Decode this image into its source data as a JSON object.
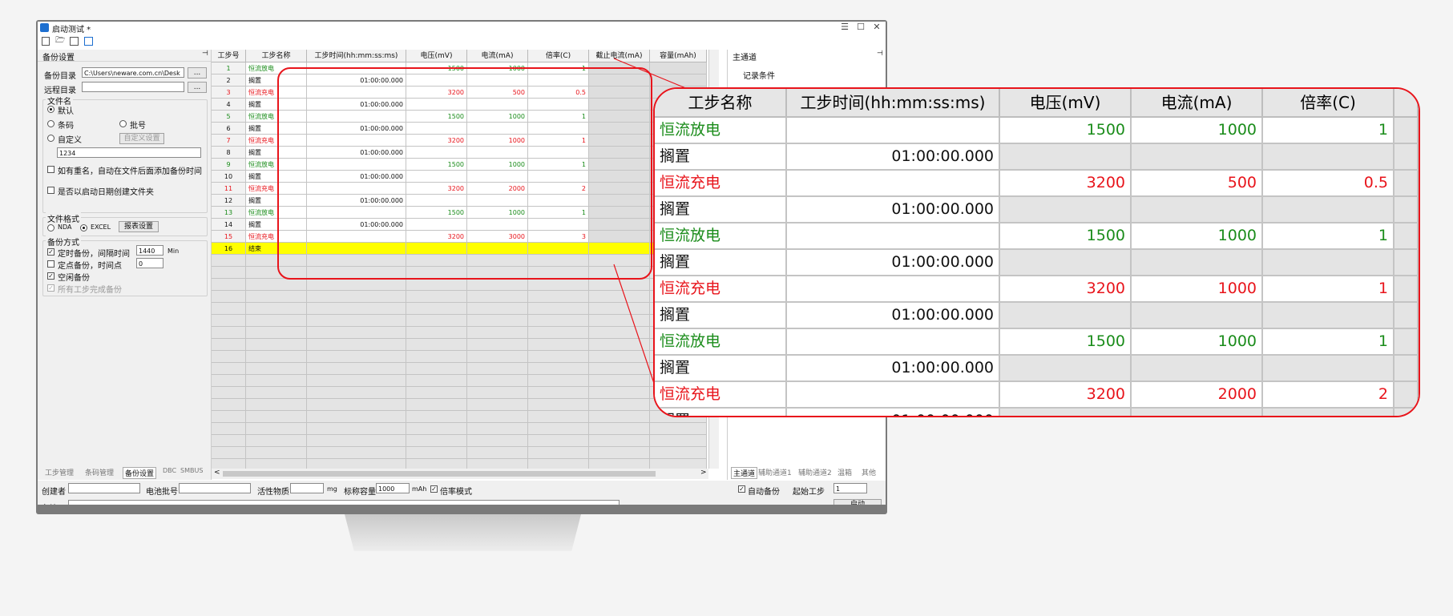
{
  "window": {
    "title": "启动测试 *",
    "controls": [
      "☰",
      "☐",
      "✕"
    ]
  },
  "toolbar": {
    "icons": [
      "new-file-icon",
      "open-folder-icon",
      "save-icon",
      "save-as-icon"
    ]
  },
  "left_panel": {
    "title": "备份设置",
    "backup_dir_label": "备份目录",
    "backup_dir_value": "C:\\Users\\neware.com.cn\\Desk",
    "remote_dir_label": "远程目录",
    "remote_dir_value": "",
    "browse": "...",
    "filename_group": "文件名",
    "opt_default": "默认",
    "opt_barcode": "条码",
    "opt_batch": "批号",
    "opt_custom": "自定义",
    "custom_settings_btn": "自定义设置",
    "custom_value": "1234",
    "chk_duplicate": "如有重名，自动在文件后面添加备份时间",
    "chk_date_folder": "是否以启动日期创建文件夹",
    "format_group": "文件格式",
    "fmt_nda": "NDA",
    "fmt_excel": "EXCEL",
    "report_settings_btn": "报表设置",
    "mode_group": "备份方式",
    "mode_timed": "定时备份，间隔时间",
    "mode_timed_value": "1440",
    "mode_timed_unit": "Min",
    "mode_fixed": "定点备份，时间点",
    "mode_fixed_value": "0",
    "mode_idle": "空闲备份",
    "mode_all_steps": "所有工步完成备份",
    "tabs": [
      "工步管理",
      "条码管理",
      "备份设置",
      "DBC",
      "SMBUS"
    ]
  },
  "table": {
    "headers": [
      "工步号",
      "工步名称",
      "工步时间(hh:mm:ss:ms)",
      "电压(mV)",
      "电流(mA)",
      "倍率(C)",
      "截止电流(mA)",
      "容量(mAh)"
    ],
    "rows": [
      {
        "no": "1",
        "name": "恒流放电",
        "time": "",
        "voltage": "1500",
        "current": "1000",
        "rate": "1",
        "color": "green"
      },
      {
        "no": "2",
        "name": "搁置",
        "time": "01:00:00.000",
        "voltage": "",
        "current": "",
        "rate": "",
        "color": "black"
      },
      {
        "no": "3",
        "name": "恒流充电",
        "time": "",
        "voltage": "3200",
        "current": "500",
        "rate": "0.5",
        "color": "red"
      },
      {
        "no": "4",
        "name": "搁置",
        "time": "01:00:00.000",
        "voltage": "",
        "current": "",
        "rate": "",
        "color": "black"
      },
      {
        "no": "5",
        "name": "恒流放电",
        "time": "",
        "voltage": "1500",
        "current": "1000",
        "rate": "1",
        "color": "green"
      },
      {
        "no": "6",
        "name": "搁置",
        "time": "01:00:00.000",
        "voltage": "",
        "current": "",
        "rate": "",
        "color": "black"
      },
      {
        "no": "7",
        "name": "恒流充电",
        "time": "",
        "voltage": "3200",
        "current": "1000",
        "rate": "1",
        "color": "red"
      },
      {
        "no": "8",
        "name": "搁置",
        "time": "01:00:00.000",
        "voltage": "",
        "current": "",
        "rate": "",
        "color": "black"
      },
      {
        "no": "9",
        "name": "恒流放电",
        "time": "",
        "voltage": "1500",
        "current": "1000",
        "rate": "1",
        "color": "green"
      },
      {
        "no": "10",
        "name": "搁置",
        "time": "01:00:00.000",
        "voltage": "",
        "current": "",
        "rate": "",
        "color": "black"
      },
      {
        "no": "11",
        "name": "恒流充电",
        "time": "",
        "voltage": "3200",
        "current": "2000",
        "rate": "2",
        "color": "red"
      },
      {
        "no": "12",
        "name": "搁置",
        "time": "01:00:00.000",
        "voltage": "",
        "current": "",
        "rate": "",
        "color": "black"
      },
      {
        "no": "13",
        "name": "恒流放电",
        "time": "",
        "voltage": "1500",
        "current": "1000",
        "rate": "1",
        "color": "green"
      },
      {
        "no": "14",
        "name": "搁置",
        "time": "01:00:00.000",
        "voltage": "",
        "current": "",
        "rate": "",
        "color": "black"
      },
      {
        "no": "15",
        "name": "恒流充电",
        "time": "",
        "voltage": "3200",
        "current": "3000",
        "rate": "3",
        "color": "red"
      },
      {
        "no": "16",
        "name": "结束",
        "time": "",
        "voltage": "",
        "current": "",
        "rate": "",
        "color": "end"
      }
    ],
    "scroll_left": "<",
    "scroll_right": ">"
  },
  "right_panel": {
    "title": "主通道",
    "record_conditions": "记录条件",
    "tabs": [
      "主通道",
      "辅助通道1",
      "辅助通道2",
      "温箱",
      "其他"
    ]
  },
  "bottom_bar": {
    "creator_label": "创建者",
    "creator_value": "",
    "batch_label": "电池批号",
    "batch_value": "",
    "active_label": "活性物质",
    "active_value": "",
    "active_unit": "mg",
    "nominal_label": "标称容量",
    "nominal_value": "1000",
    "nominal_unit": "mAh",
    "rate_mode": "倍率模式",
    "auto_backup": "自动备份",
    "start_step_label": "起始工步",
    "start_step_value": "1",
    "start_button": "启动",
    "remark_label": "备注",
    "remark_value": ""
  },
  "zoom": {
    "headers": [
      "工步名称",
      "工步时间(hh:mm:ss:ms)",
      "电压(mV)",
      "电流(mA)",
      "倍率(C)"
    ],
    "partial_row_time": "01:00:00.000"
  },
  "colors": {
    "green": "#1a8c1a",
    "red": "#e8141b",
    "end_row": "#ffff00",
    "accent": "#e8141b"
  }
}
